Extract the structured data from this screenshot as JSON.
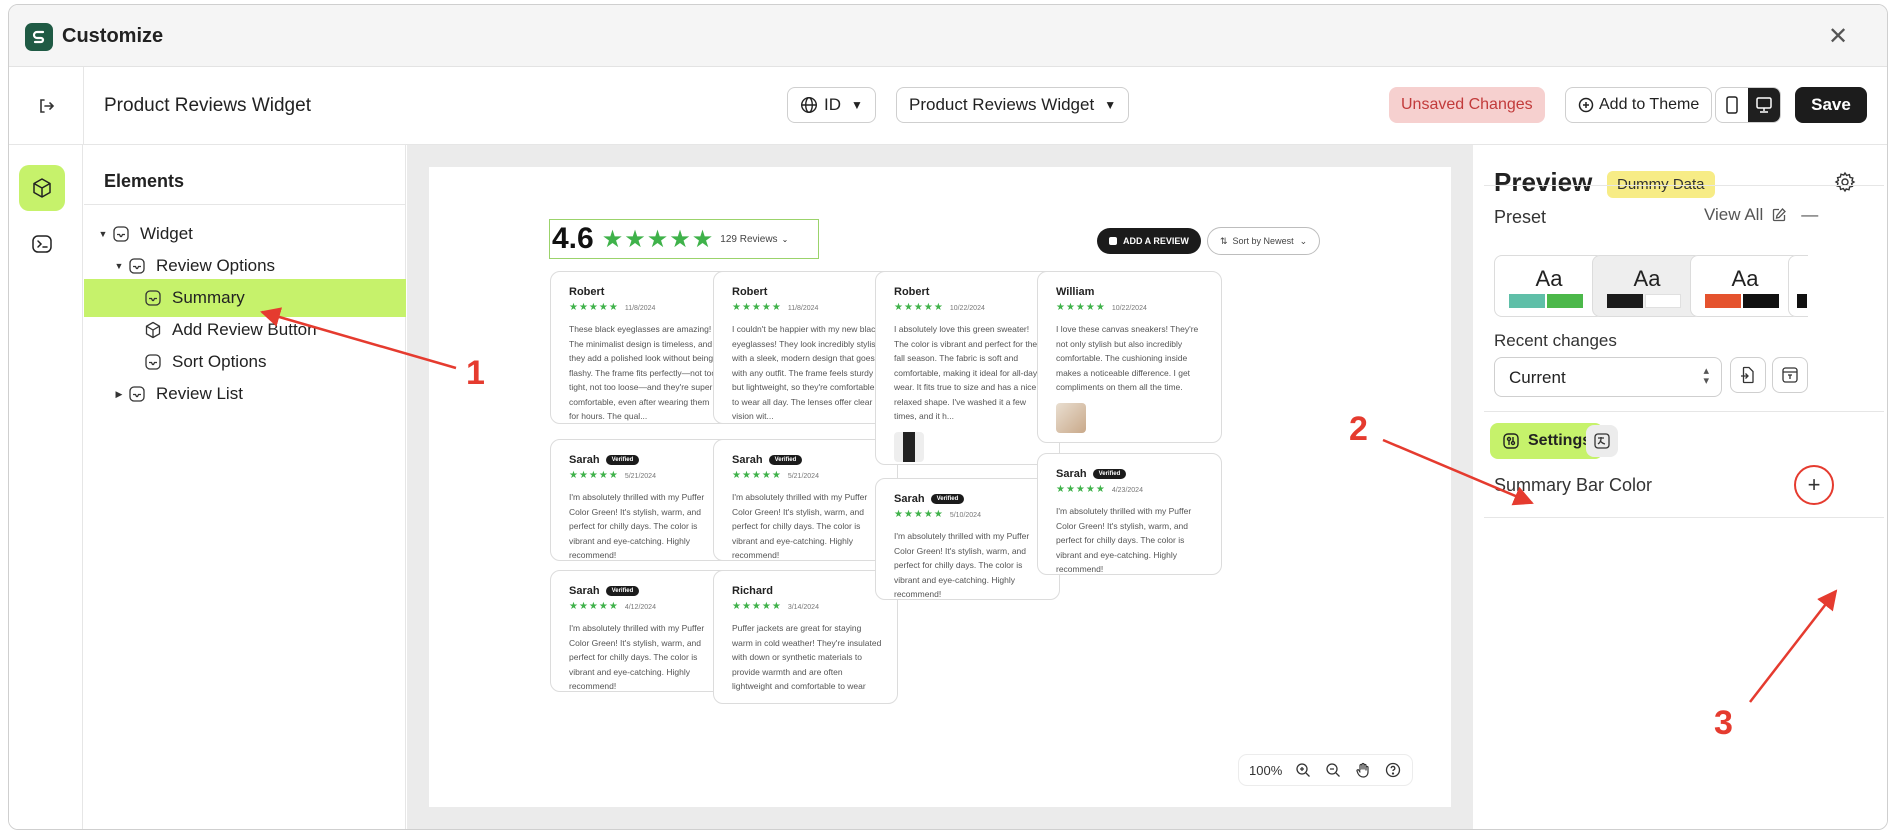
{
  "window": {
    "title": "Customize",
    "close_glyph": "✕"
  },
  "topbar": {
    "page_title": "Product Reviews Widget",
    "language": "ID",
    "widget_select": "Product Reviews Widget",
    "unsaved": "Unsaved Changes",
    "add_to_theme": "Add to Theme",
    "save": "Save"
  },
  "elements": {
    "title": "Elements",
    "tree": [
      {
        "label": "Widget"
      },
      {
        "label": "Review Options"
      },
      {
        "label": "Summary"
      },
      {
        "label": "Add Review Button"
      },
      {
        "label": "Sort Options"
      },
      {
        "label": "Review List"
      }
    ]
  },
  "canvas": {
    "rating": "4.6",
    "rating_stars": "★★★★★",
    "review_count": "129 Reviews",
    "add_review": "ADD A REVIEW",
    "sort_label": "Sort by Newest",
    "star_color": "#3fb24a",
    "reviews": [
      {
        "name": "Robert",
        "stars": "★★★★★",
        "date": "11/8/2024",
        "text": "These black eyeglasses are amazing! The minimalist design is timeless, and they add a polished look without being flashy. The frame fits perfectly—not too tight, not too loose—and they're super comfortable, even after wearing them for hours. The qual..."
      },
      {
        "name": "Robert",
        "stars": "★★★★★",
        "date": "11/8/2024",
        "text": "I couldn't be happier with my new black eyeglasses! They look incredibly stylish, with a sleek, modern design that goes with any outfit. The frame feels sturdy but lightweight, so they're comfortable to wear all day. The lenses offer clear vision wit..."
      },
      {
        "name": "Robert",
        "stars": "★★★★★",
        "date": "10/22/2024",
        "text": "I absolutely love this green sweater! The color is vibrant and perfect for the fall season. The fabric is soft and comfortable, making it ideal for all-day wear. It fits true to size and has a nice, relaxed shape. I've washed it a few times, and it h..."
      },
      {
        "name": "William",
        "stars": "★★★★★",
        "date": "10/22/2024",
        "text": "I love these canvas sneakers! They're not only stylish but also incredibly comfortable. The cushioning inside makes a noticeable difference. I get compliments on them all the time."
      },
      {
        "name": "Sarah",
        "badge": "Verified",
        "stars": "★★★★★",
        "date": "5/21/2024",
        "text": "I'm absolutely thrilled with my Puffer Color Green! It's stylish, warm, and perfect for chilly days. The color is vibrant and eye-catching. Highly recommend!"
      },
      {
        "name": "Sarah",
        "badge": "Verified",
        "stars": "★★★★★",
        "date": "5/21/2024",
        "text": "I'm absolutely thrilled with my Puffer Color Green! It's stylish, warm, and perfect for chilly days. The color is vibrant and eye-catching. Highly recommend!"
      },
      {
        "name": "Sarah",
        "badge": "Verified",
        "stars": "★★★★★",
        "date": "5/10/2024",
        "text": "I'm absolutely thrilled with my Puffer Color Green! It's stylish, warm, and perfect for chilly days. The color is vibrant and eye-catching. Highly recommend!"
      },
      {
        "name": "Sarah",
        "badge": "Verified",
        "stars": "★★★★★",
        "date": "4/23/2024",
        "text": "I'm absolutely thrilled with my Puffer Color Green! It's stylish, warm, and perfect for chilly days. The color is vibrant and eye-catching. Highly recommend!"
      },
      {
        "name": "Sarah",
        "badge": "Verified",
        "stars": "★★★★★",
        "date": "4/12/2024",
        "text": "I'm absolutely thrilled with my Puffer Color Green! It's stylish, warm, and perfect for chilly days. The color is vibrant and eye-catching. Highly recommend!"
      },
      {
        "name": "Richard",
        "stars": "★★★★★",
        "date": "3/14/2024",
        "text": "Puffer jackets are great for staying warm in cold weather! They're insulated with down or synthetic materials to provide warmth and are often lightweight and comfortable to wear"
      }
    ],
    "zoom": "100%"
  },
  "preview": {
    "title": "Preview",
    "badge": "Dummy Data",
    "preset_label": "Preset",
    "view_all": "View All",
    "preset_sample": "Aa",
    "presets": [
      {
        "c1": "#5fbfa8",
        "c2": "#4cb84a"
      },
      {
        "c1": "#1b1b1b",
        "c2": "#ffffff"
      },
      {
        "c1": "#e5532e",
        "c2": "#111111"
      }
    ],
    "recent_label": "Recent changes",
    "recent_value": "Current",
    "settings_tab": "Settings",
    "summary_bar_color": "Summary Bar Color",
    "accent": "#c6f26b"
  },
  "annotations": {
    "a1": "1",
    "a2": "2",
    "a3": "3",
    "color": "#e53b2f"
  }
}
